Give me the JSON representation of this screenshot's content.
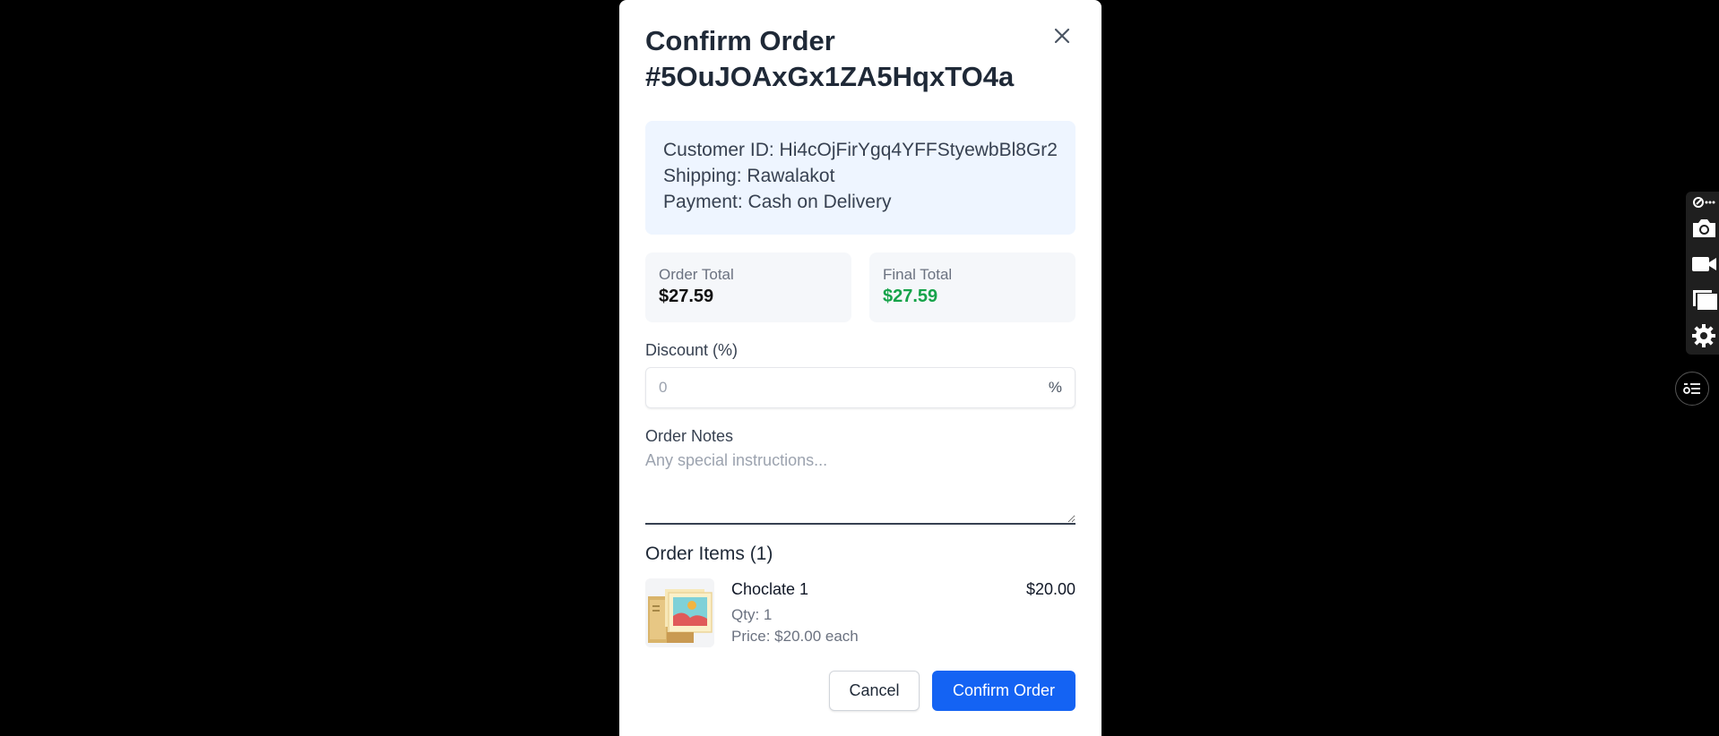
{
  "modal": {
    "title": "Confirm Order #5OuJOAxGx1ZA5HqxTO4a",
    "customer_id": "Customer ID: Hi4cOjFirYgq4YFFStyewbBl8Gr2",
    "shipping": "Shipping: Rawalakot",
    "payment": "Payment: Cash on Delivery",
    "order_total_label": "Order Total",
    "order_total_value": "$27.59",
    "final_total_label": "Final Total",
    "final_total_value": "$27.59",
    "discount_label": "Discount (%)",
    "discount_placeholder": "0",
    "discount_suffix": "%",
    "notes_label": "Order Notes",
    "notes_placeholder": "Any special instructions...",
    "items_title": "Order Items (1)",
    "items": [
      {
        "name": "Choclate 1",
        "qty": "Qty: 1",
        "price_each": "Price: $20.00 each",
        "line_total": "$20.00"
      }
    ],
    "cancel_label": "Cancel",
    "confirm_label": "Confirm Order"
  },
  "colors": {
    "accent": "#1463f3",
    "success": "#16a34a",
    "info_bg": "#eef5ff"
  },
  "toolbar_icons": [
    "extension-menu-icon",
    "camera-icon",
    "video-icon",
    "windows-icon",
    "gear-icon"
  ],
  "floating_icon": "task-list-icon"
}
